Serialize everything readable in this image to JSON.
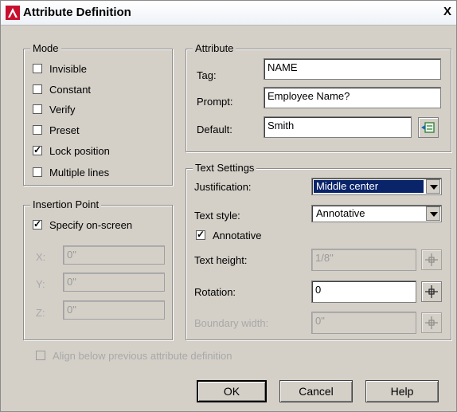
{
  "title": "Attribute Definition",
  "close_label": "X",
  "mode": {
    "legend": "Mode",
    "items": [
      {
        "label": "Invisible",
        "checked": false
      },
      {
        "label": "Constant",
        "checked": false
      },
      {
        "label": "Verify",
        "checked": false
      },
      {
        "label": "Preset",
        "checked": false
      },
      {
        "label": "Lock position",
        "checked": true
      },
      {
        "label": "Multiple lines",
        "checked": false
      }
    ]
  },
  "attribute": {
    "legend": "Attribute",
    "tag_label": "Tag:",
    "tag_value": "NAME",
    "prompt_label": "Prompt:",
    "prompt_value": "Employee Name?",
    "default_label": "Default:",
    "default_value": "Smith"
  },
  "insertion": {
    "legend": "Insertion Point",
    "specify_label": "Specify on-screen",
    "specify_checked": true,
    "x_label": "X:",
    "x_value": "0\"",
    "y_label": "Y:",
    "y_value": "0\"",
    "z_label": "Z:",
    "z_value": "0\""
  },
  "text_settings": {
    "legend": "Text Settings",
    "justification_label": "Justification:",
    "justification_value": "Middle center",
    "style_label": "Text style:",
    "style_value": "Annotative",
    "annotative_label": "Annotative",
    "annotative_checked": true,
    "height_label": "Text height:",
    "height_value": "1/8\"",
    "rotation_label": "Rotation:",
    "rotation_value": "0",
    "boundary_label": "Boundary width:",
    "boundary_value": "0\""
  },
  "align_label": "Align below previous attribute definition",
  "buttons": {
    "ok": "OK",
    "cancel": "Cancel",
    "help": "Help"
  },
  "colors": {
    "dialog_bg": "#d4d0c8",
    "focus": "#0a246a"
  }
}
